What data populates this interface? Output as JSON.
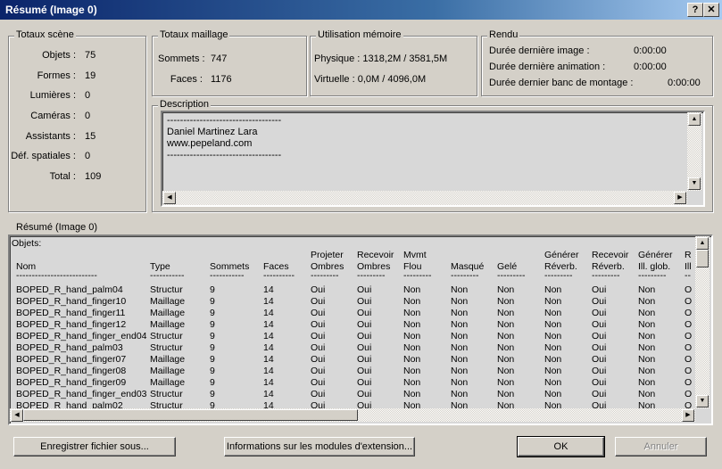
{
  "window": {
    "title": "Résumé (Image 0)",
    "help_label": "?",
    "close_label": "✕"
  },
  "scene_totals": {
    "title": "Totaux scène",
    "rows": [
      {
        "label": "Objets :",
        "value": "75"
      },
      {
        "label": "Formes :",
        "value": "19"
      },
      {
        "label": "Lumières :",
        "value": "0"
      },
      {
        "label": "Caméras :",
        "value": "0"
      },
      {
        "label": "Assistants :",
        "value": "15"
      },
      {
        "label": "Déf. spatiales :",
        "value": "0"
      },
      {
        "label": "Total :",
        "value": "109"
      }
    ]
  },
  "mesh_totals": {
    "title": "Totaux maillage",
    "rows": [
      {
        "label": "Sommets :",
        "value": "747"
      },
      {
        "label": "Faces :",
        "value": "1176"
      }
    ]
  },
  "memory": {
    "title": "Utilisation mémoire",
    "physical": "Physique : 1318,2M / 3581,5M",
    "virtual": "Virtuelle :  0,0M / 4096,0M"
  },
  "render": {
    "title": "Rendu",
    "rows": [
      {
        "label": "Durée dernière image :",
        "value": "0:00:00"
      },
      {
        "label": "Durée dernière animation :",
        "value": "0:00:00"
      },
      {
        "label": "Durée dernier banc de montage :",
        "value": "0:00:00"
      }
    ]
  },
  "description": {
    "title": "Description",
    "lines": [
      "-----------------------------------",
      "Daniel Martinez Lara",
      "www.pepeland.com",
      "-----------------------------------"
    ]
  },
  "summary": {
    "title": "Résumé (Image 0)",
    "section_label": "Objets:",
    "columns": [
      {
        "l1": "",
        "l2": "Nom",
        "dash": "--------------------------"
      },
      {
        "l1": "",
        "l2": "Type",
        "dash": "-----------"
      },
      {
        "l1": "",
        "l2": "Sommets",
        "dash": "-----------"
      },
      {
        "l1": "",
        "l2": "Faces",
        "dash": "----------"
      },
      {
        "l1": "Projeter",
        "l2": "Ombres",
        "dash": "---------"
      },
      {
        "l1": "Recevoir",
        "l2": "Ombres",
        "dash": "---------"
      },
      {
        "l1": "Mvmt",
        "l2": "Flou",
        "dash": "---------"
      },
      {
        "l1": "",
        "l2": "Masqué",
        "dash": "---------"
      },
      {
        "l1": "",
        "l2": "Gelé",
        "dash": "---------"
      },
      {
        "l1": "Générer",
        "l2": "Réverb.",
        "dash": "---------"
      },
      {
        "l1": "Recevoir",
        "l2": "Réverb.",
        "dash": "---------"
      },
      {
        "l1": "Générer",
        "l2": "Ill. glob.",
        "dash": "---------"
      },
      {
        "l1": "R",
        "l2": "Ill",
        "dash": "--"
      }
    ],
    "rows": [
      [
        "BOPED_R_hand_palm04",
        "Structur",
        "9",
        "14",
        "Oui",
        "Oui",
        "Non",
        "Non",
        "Non",
        "Non",
        "Oui",
        "Non",
        "O"
      ],
      [
        "BOPED_R_hand_finger10",
        "Maillage",
        "9",
        "14",
        "Oui",
        "Oui",
        "Non",
        "Non",
        "Non",
        "Non",
        "Oui",
        "Non",
        "O"
      ],
      [
        "BOPED_R_hand_finger11",
        "Maillage",
        "9",
        "14",
        "Oui",
        "Oui",
        "Non",
        "Non",
        "Non",
        "Non",
        "Oui",
        "Non",
        "O"
      ],
      [
        "BOPED_R_hand_finger12",
        "Maillage",
        "9",
        "14",
        "Oui",
        "Oui",
        "Non",
        "Non",
        "Non",
        "Non",
        "Oui",
        "Non",
        "O"
      ],
      [
        "BOPED_R_hand_finger_end04",
        "Structur",
        "9",
        "14",
        "Oui",
        "Oui",
        "Non",
        "Non",
        "Non",
        "Non",
        "Oui",
        "Non",
        "O"
      ],
      [
        "BOPED_R_hand_palm03",
        "Structur",
        "9",
        "14",
        "Oui",
        "Oui",
        "Non",
        "Non",
        "Non",
        "Non",
        "Oui",
        "Non",
        "O"
      ],
      [
        "BOPED_R_hand_finger07",
        "Maillage",
        "9",
        "14",
        "Oui",
        "Oui",
        "Non",
        "Non",
        "Non",
        "Non",
        "Oui",
        "Non",
        "O"
      ],
      [
        "BOPED_R_hand_finger08",
        "Maillage",
        "9",
        "14",
        "Oui",
        "Oui",
        "Non",
        "Non",
        "Non",
        "Non",
        "Oui",
        "Non",
        "O"
      ],
      [
        "BOPED_R_hand_finger09",
        "Maillage",
        "9",
        "14",
        "Oui",
        "Oui",
        "Non",
        "Non",
        "Non",
        "Non",
        "Oui",
        "Non",
        "O"
      ],
      [
        "BOPED_R_hand_finger_end03",
        "Structur",
        "9",
        "14",
        "Oui",
        "Oui",
        "Non",
        "Non",
        "Non",
        "Non",
        "Oui",
        "Non",
        "O"
      ],
      [
        "BOPED_R_hand_palm02",
        "Structur",
        "9",
        "14",
        "Oui",
        "Oui",
        "Non",
        "Non",
        "Non",
        "Non",
        "Oui",
        "Non",
        "O"
      ]
    ]
  },
  "buttons": {
    "save": "Enregistrer fichier sous...",
    "plugins": "Informations sur les modules d'extension...",
    "ok": "OK",
    "cancel": "Annuler"
  }
}
